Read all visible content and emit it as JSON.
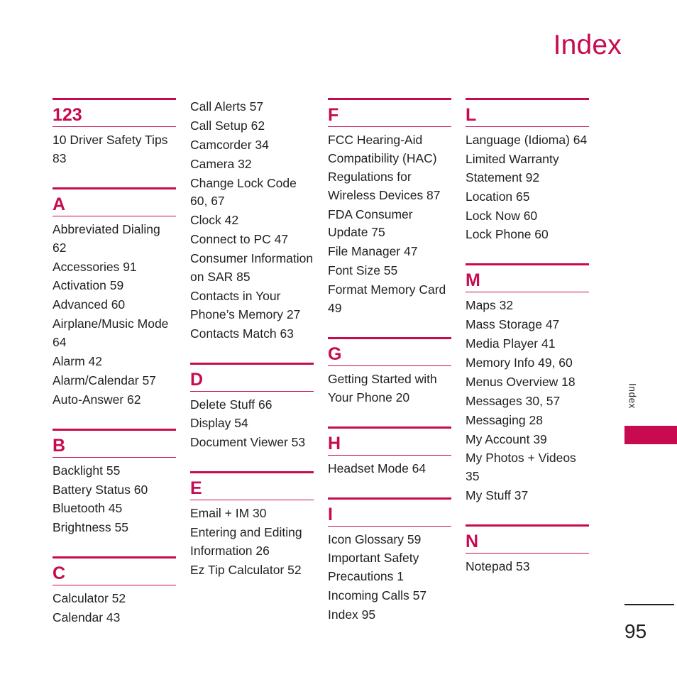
{
  "header": {
    "title": "Index"
  },
  "side_tab": {
    "label": "Index"
  },
  "folio": {
    "page_number": "95"
  },
  "colors": {
    "accent": "#c80a50",
    "text": "#231f20",
    "background": "#ffffff"
  },
  "columns": [
    {
      "id": "column-1",
      "sections": [
        {
          "letter": "123",
          "entries": [
            "10 Driver Safety Tips 83"
          ]
        },
        {
          "letter": "A",
          "entries": [
            "Abbreviated Dialing 62",
            "Accessories 91",
            "Activation 59",
            "Advanced 60",
            "Airplane/Music Mode 64",
            "Alarm 42",
            "Alarm/Calendar 57",
            "Auto-Answer 62"
          ]
        },
        {
          "letter": "B",
          "entries": [
            "Backlight 55",
            "Battery Status 60",
            "Bluetooth 45",
            "Brightness 55"
          ]
        },
        {
          "letter": "C",
          "entries": [
            "Calculator 52",
            "Calendar 43"
          ]
        }
      ]
    },
    {
      "id": "column-2",
      "sections": [
        {
          "letter": "",
          "continued": true,
          "entries": [
            "Call Alerts 57",
            "Call Setup 62",
            "Camcorder 34",
            "Camera 32",
            "Change Lock Code 60, 67",
            "Clock 42",
            "Connect to PC 47",
            "Consumer Information on SAR 85",
            "Contacts in Your Phone’s Memory 27",
            "Contacts Match 63"
          ]
        },
        {
          "letter": "D",
          "entries": [
            "Delete Stuff 66",
            "Display 54",
            "Document Viewer 53"
          ]
        },
        {
          "letter": "E",
          "entries": [
            "Email + IM 30",
            "Entering and Editing Information 26",
            "Ez Tip Calculator 52"
          ]
        }
      ]
    },
    {
      "id": "column-3",
      "sections": [
        {
          "letter": "F",
          "entries": [
            "FCC Hearing-Aid Compatibility (HAC) Regulations for Wireless Devices 87",
            "FDA Consumer Update 75",
            "File Manager 47",
            "Font Size 55",
            "Format Memory Card 49"
          ]
        },
        {
          "letter": "G",
          "entries": [
            "Getting Started with Your Phone 20"
          ]
        },
        {
          "letter": "H",
          "entries": [
            "Headset Mode 64"
          ]
        },
        {
          "letter": "I",
          "entries": [
            "Icon Glossary 59",
            "Important Safety Precautions 1",
            "Incoming Calls 57",
            "Index 95"
          ]
        }
      ]
    },
    {
      "id": "column-4",
      "sections": [
        {
          "letter": "L",
          "entries": [
            "Language (Idioma) 64",
            "Limited Warranty Statement 92",
            "Location 65",
            "Lock Now 60",
            "Lock Phone 60"
          ]
        },
        {
          "letter": "M",
          "entries": [
            "Maps 32",
            "Mass Storage 47",
            "Media Player 41",
            "Memory Info 49, 60",
            "Menus Overview 18",
            "Messages 30, 57",
            "Messaging 28",
            "My Account 39",
            "My Photos + Videos 35",
            "My Stuff 37"
          ]
        },
        {
          "letter": "N",
          "entries": [
            "Notepad 53"
          ]
        }
      ]
    }
  ]
}
